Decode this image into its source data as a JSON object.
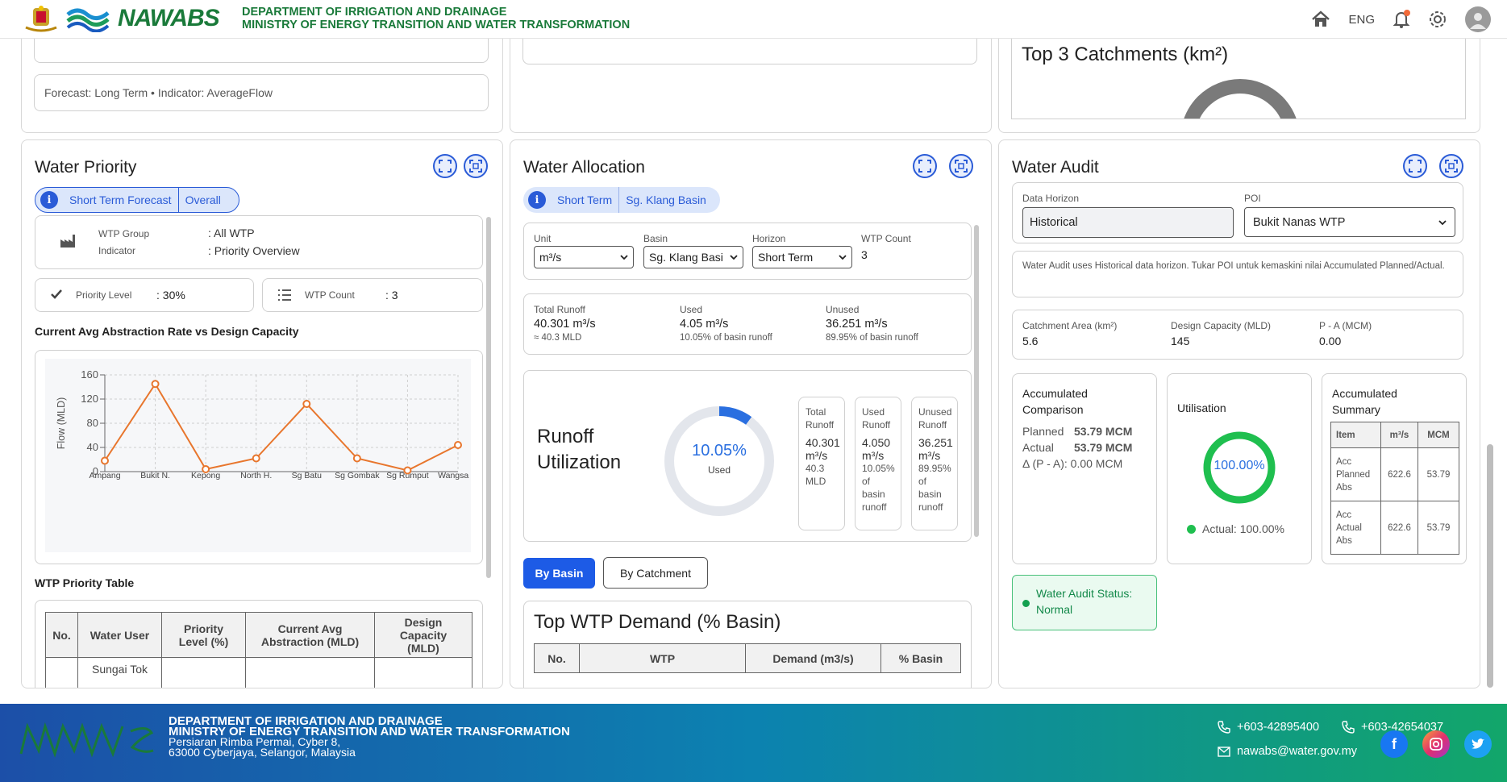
{
  "header": {
    "title_line1": "DEPARTMENT OF IRRIGATION AND DRAINAGE",
    "title_line2": "MINISTRY OF ENERGY TRANSITION AND WATER TRANSFORMATION",
    "logo_text": "NAWABS",
    "lang": "ENG",
    "colors": {
      "title": "#1a7a3a"
    }
  },
  "top_left": {
    "forecast_text": "Forecast: Long Term • Indicator: AverageFlow"
  },
  "top_right": {
    "title": "Top 3 Catchments (km²)"
  },
  "priority": {
    "title": "Water Priority",
    "chip": [
      "Short Term Forecast",
      "Overall"
    ],
    "wtp_group_label": "WTP Group",
    "wtp_group_value": ": All WTP",
    "indicator_label": "Indicator",
    "indicator_value": ": Priority Overview",
    "priority_level_label": "Priority Level",
    "priority_level_value": ": 30%",
    "wtp_count_label": "WTP Count",
    "wtp_count_value": ": 3",
    "chart_heading": "Current Avg Abstraction Rate vs Design Capacity",
    "table_heading": "WTP Priority Table",
    "table_headers": [
      "No.",
      "Water User",
      "Priority Level (%)",
      "Current Avg Abstraction (MLD)",
      "Design Capacity (MLD)"
    ],
    "table_first_cell": "Sungai Tok"
  },
  "chart_data": {
    "type": "line",
    "categories": [
      "Ampang",
      "Bukit N.",
      "Kepong",
      "North H.",
      "Sg Batu",
      "Sg Gombak",
      "Sg Rumput",
      "Wangsa M"
    ],
    "values": [
      18,
      145,
      4,
      22,
      112,
      22,
      2,
      44
    ],
    "ylabel": "Flow (MLD)",
    "yticks": [
      "0",
      "40",
      "80",
      "120",
      "160"
    ],
    "ylim": [
      0,
      160
    ],
    "grid": true,
    "color": "#e8762d"
  },
  "allocation": {
    "title": "Water Allocation",
    "chip": [
      "Short Term",
      "Sg. Klang Basin"
    ],
    "unit_label": "Unit",
    "unit_value": "m³/s",
    "basin_label": "Basin",
    "basin_value": "Sg. Klang Basi",
    "horizon_label": "Horizon",
    "horizon_value": "Short Term",
    "wtpcount_label": "WTP Count",
    "wtpcount_value": "3",
    "total_label": "Total Runoff",
    "total_value": "40.301 m³/s",
    "total_sub": "≈ 40.3 MLD",
    "used_label": "Used",
    "used_value": "4.05 m³/s",
    "used_sub": "10.05% of basin runoff",
    "unused_label": "Unused",
    "unused_value": "36.251 m³/s",
    "unused_sub": "89.95% of basin runoff",
    "runoff_title_1": "Runoff",
    "runoff_title_2": "Utilization",
    "donut_pct": "10.05%",
    "donut_label": "Used",
    "donut_fraction": 0.1005,
    "mini": [
      {
        "l1": "Total",
        "l2": "Runoff",
        "v1": "40.301",
        "v2": "m³/s",
        "s1": "40.3",
        "s2": "MLD"
      },
      {
        "l1": "Used",
        "l2": "Runoff",
        "v1": "4.050",
        "v2": "m³/s",
        "s1": "10.05%",
        "s2": "of",
        "s3": "basin",
        "s4": "runoff"
      },
      {
        "l1": "Unused",
        "l2": "Runoff",
        "v1": "36.251",
        "v2": "m³/s",
        "s1": "89.95%",
        "s2": "of",
        "s3": "basin",
        "s4": "runoff"
      }
    ],
    "by_basin": "By Basin",
    "by_catchment": "By Catchment",
    "demand_title": "Top WTP Demand (% Basin)",
    "demand_headers": [
      "No.",
      "WTP",
      "Demand (m3/s)",
      "% Basin"
    ]
  },
  "audit": {
    "title": "Water Audit",
    "horizon_label": "Data Horizon",
    "horizon_value": "Historical",
    "poi_label": "POI",
    "poi_value": "Bukit Nanas WTP",
    "note": "Water Audit uses Historical data horizon. Tukar POI untuk kemaskini nilai Accumulated Planned/Actual.",
    "catchment_label": "Catchment Area (km²)",
    "catchment_value": "5.6",
    "design_label": "Design Capacity (MLD)",
    "design_value": "145",
    "pa_label": "P - A (MCM)",
    "pa_value": "0.00",
    "acc_comp_title_1": "Accumulated",
    "acc_comp_title_2": "Comparison",
    "planned_label": "Planned",
    "planned_value": "53.79 MCM",
    "actual_label": "Actual",
    "actual_value": "53.79 MCM",
    "delta_text": "Δ (P - A): 0.00 MCM",
    "util_title": "Utilisation",
    "util_pct": "100.00%",
    "util_fraction": 1.0,
    "util_legend": "Actual: 100.00%",
    "acc_sum_title_1": "Accumulated",
    "acc_sum_title_2": "Summary",
    "sum_headers": [
      "Item",
      "m³/s",
      "MCM"
    ],
    "sum_rows": [
      {
        "item": [
          "Acc",
          "Planned",
          "Abs"
        ],
        "m3s": "622.6",
        "mcm": "53.79"
      },
      {
        "item": [
          "Acc",
          "Actual",
          "Abs"
        ],
        "m3s": "622.6",
        "mcm": "53.79"
      }
    ],
    "status_1": "Water Audit Status:",
    "status_2": "Normal",
    "colors": {
      "util": "#1fbf4f",
      "status": "#13894a"
    }
  },
  "footer": {
    "line1": "DEPARTMENT OF IRRIGATION AND DRAINAGE",
    "line2": "MINISTRY OF ENERGY TRANSITION AND WATER TRANSFORMATION",
    "addr1": "Persiaran Rimba Permai, Cyber 8,",
    "addr2": "63000 Cyberjaya, Selangor, Malaysia",
    "phone1": "+603-42895400",
    "phone2": "+603-42654037",
    "email": "nawabs@water.gov.my"
  }
}
